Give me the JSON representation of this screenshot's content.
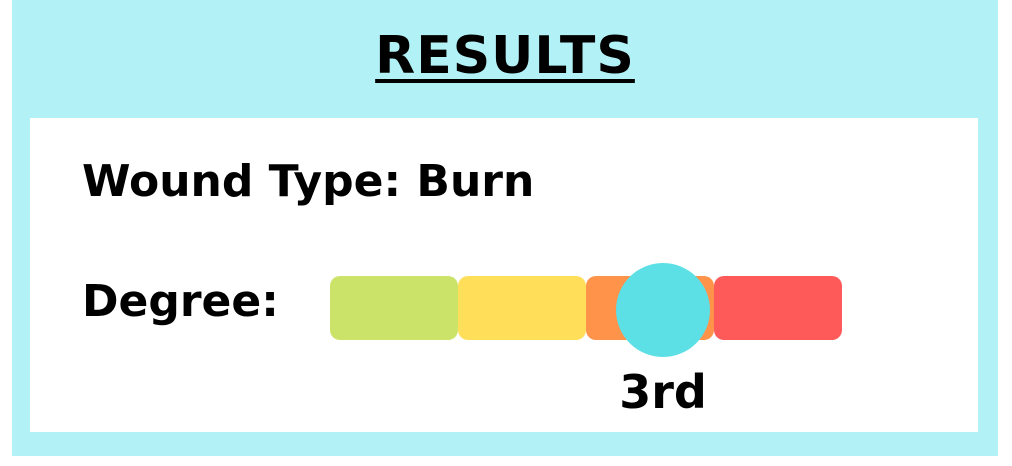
{
  "header": {
    "title": "RESULTS",
    "background_color": "#b2f2f7"
  },
  "results": {
    "wound_label": "Wound Type:",
    "wound_value": "Burn",
    "degree_label": "Degree:",
    "degree_value": "3rd",
    "degree_level_index": 3,
    "degree_level_count": 4
  },
  "severity_scale": {
    "segment_colors": [
      "#cce369",
      "#ffdf5a",
      "#ff934a",
      "#ff5a5a"
    ],
    "indicator_color": "#5ddfe6"
  }
}
